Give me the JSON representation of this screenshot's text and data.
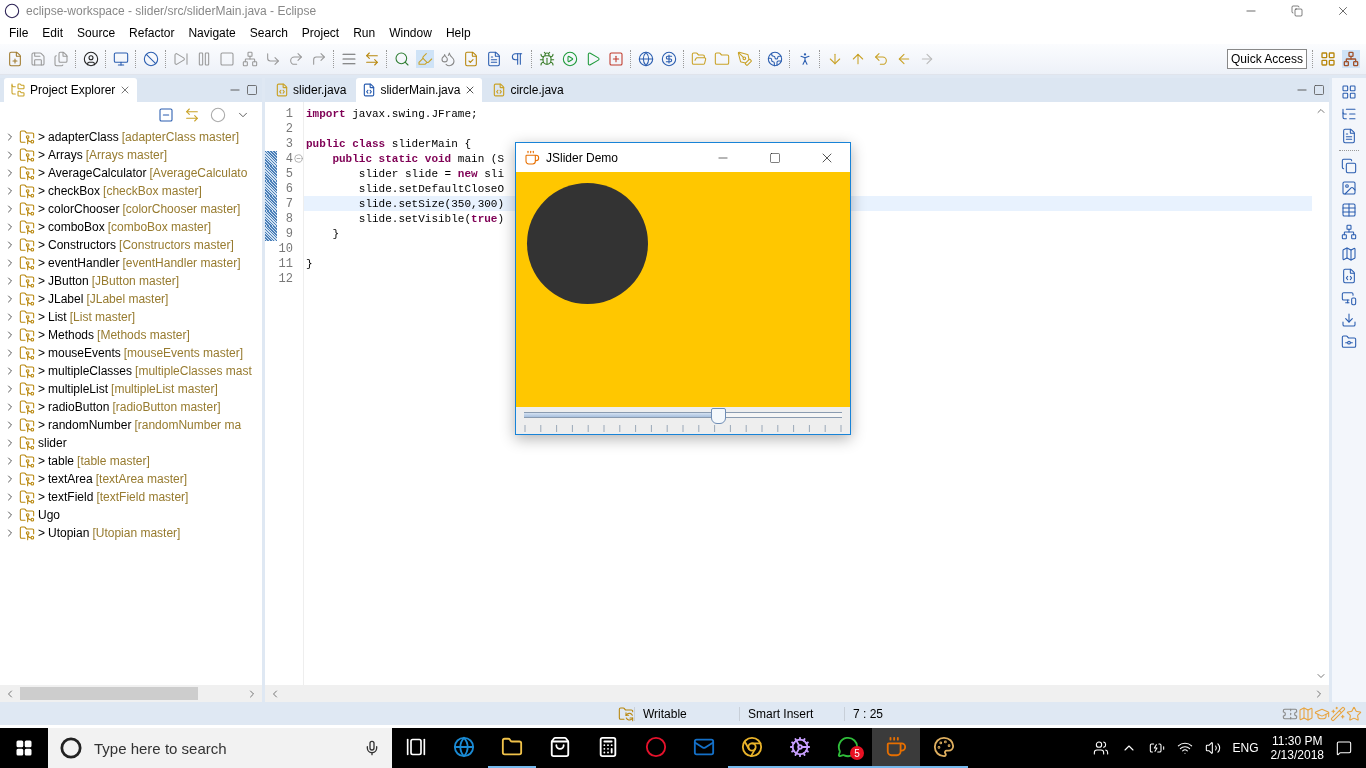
{
  "window": {
    "title": "eclipse-workspace - slider/src/sliderMain.java - Eclipse"
  },
  "menu": [
    "File",
    "Edit",
    "Source",
    "Refactor",
    "Navigate",
    "Search",
    "Project",
    "Run",
    "Window",
    "Help"
  ],
  "quick_access": {
    "placeholder": "Quick Access"
  },
  "project_explorer": {
    "title": "Project Explorer",
    "items": [
      {
        "name": "adapterClass",
        "marker": ">",
        "repo": "[adapterClass master]",
        "expanded": false
      },
      {
        "name": "Arrays",
        "marker": ">",
        "repo": "[Arrays master]",
        "expanded": false
      },
      {
        "name": "AverageCalculator",
        "marker": ">",
        "repo": "[AverageCalculato",
        "expanded": false
      },
      {
        "name": "checkBox",
        "marker": ">",
        "repo": "[checkBox master]",
        "expanded": false
      },
      {
        "name": "colorChooser",
        "marker": ">",
        "repo": "[colorChooser master]",
        "expanded": false
      },
      {
        "name": "comboBox",
        "marker": ">",
        "repo": "[comboBox master]",
        "expanded": false
      },
      {
        "name": "Constructors",
        "marker": ">",
        "repo": "[Constructors master]",
        "expanded": false
      },
      {
        "name": "eventHandler",
        "marker": ">",
        "repo": "[eventHandler master]",
        "expanded": false
      },
      {
        "name": "JButton",
        "marker": ">",
        "repo": "[JButton master]",
        "expanded": false
      },
      {
        "name": "JLabel",
        "marker": ">",
        "repo": "[JLabel master]",
        "expanded": false
      },
      {
        "name": "List",
        "marker": ">",
        "repo": "[List master]",
        "expanded": false
      },
      {
        "name": "Methods",
        "marker": ">",
        "repo": "[Methods master]",
        "expanded": false
      },
      {
        "name": "mouseEvents",
        "marker": ">",
        "repo": "[mouseEvents master]",
        "expanded": false
      },
      {
        "name": "multipleClasses",
        "marker": ">",
        "repo": "[multipleClasses mast",
        "expanded": false
      },
      {
        "name": "multipleList",
        "marker": ">",
        "repo": "[multipleList master]",
        "expanded": false
      },
      {
        "name": "radioButton",
        "marker": ">",
        "repo": "[radioButton master]",
        "expanded": false
      },
      {
        "name": "randomNumber",
        "marker": ">",
        "repo": "[randomNumber ma",
        "expanded": false
      },
      {
        "name": "slider",
        "expanded": false
      },
      {
        "name": "table",
        "marker": ">",
        "repo": "[table master]",
        "expanded": false
      },
      {
        "name": "textArea",
        "marker": ">",
        "repo": "[textArea master]",
        "expanded": false
      },
      {
        "name": "textField",
        "marker": ">",
        "repo": "[textField master]",
        "expanded": false
      },
      {
        "name": "Ugo",
        "expanded": false
      },
      {
        "name": "Utopian",
        "marker": ">",
        "repo": "[Utopian master]",
        "expanded": false
      }
    ]
  },
  "editor": {
    "tabs": [
      {
        "label": "slider.java",
        "selected": false,
        "warning": true
      },
      {
        "label": "sliderMain.java",
        "selected": true,
        "warning": false
      },
      {
        "label": "circle.java",
        "selected": false,
        "warning": true
      }
    ],
    "lines": [
      {
        "number": "1",
        "current": false,
        "changed": false,
        "foldable": false,
        "tokens": [
          {
            "kind": "keyword",
            "text": "import"
          },
          {
            "kind": "plain",
            "text": " javax.swing.JFrame;"
          }
        ]
      },
      {
        "number": "2",
        "current": false,
        "changed": false,
        "foldable": false
      },
      {
        "number": "3",
        "current": false,
        "changed": false,
        "foldable": false,
        "tokens": [
          {
            "kind": "keyword",
            "text": "public class"
          },
          {
            "kind": "plain",
            "text": " sliderMain {"
          }
        ]
      },
      {
        "number": "4",
        "current": false,
        "changed": true,
        "foldable": true,
        "tokens": [
          {
            "kind": "keyword",
            "text": "    public static void"
          },
          {
            "kind": "plain",
            "text": " main (S"
          }
        ]
      },
      {
        "number": "5",
        "current": false,
        "changed": true,
        "foldable": false,
        "tokens": [
          {
            "kind": "plain",
            "text": "        slider slide = "
          },
          {
            "kind": "keyword",
            "text": "new"
          },
          {
            "kind": "plain",
            "text": " sli"
          }
        ]
      },
      {
        "number": "6",
        "current": false,
        "changed": true,
        "foldable": false,
        "tokens": [
          {
            "kind": "plain",
            "text": "        slide.setDefaultCloseO"
          }
        ]
      },
      {
        "number": "7",
        "current": true,
        "changed": true,
        "foldable": false,
        "tokens": [
          {
            "kind": "plain",
            "text": "        slide.setSize(350,300)"
          }
        ]
      },
      {
        "number": "8",
        "current": false,
        "changed": true,
        "foldable": false,
        "tokens": [
          {
            "kind": "plain",
            "text": "        slide.setVisible("
          },
          {
            "kind": "keyword",
            "text": "true"
          },
          {
            "kind": "plain",
            "text": ")"
          }
        ]
      },
      {
        "number": "9",
        "current": false,
        "changed": true,
        "foldable": false,
        "tokens": [
          {
            "kind": "plain",
            "text": "    }"
          }
        ]
      },
      {
        "number": "10",
        "current": false,
        "changed": false,
        "foldable": false
      },
      {
        "number": "11",
        "current": false,
        "changed": false,
        "foldable": false,
        "tokens": [
          {
            "kind": "plain",
            "text": "}"
          }
        ]
      },
      {
        "number": "12",
        "current": false,
        "changed": false,
        "foldable": false
      }
    ]
  },
  "demo_window": {
    "title": "JSlider Demo",
    "slider": {
      "level": 0.61
    }
  },
  "status_bar": [
    "Writable",
    "Smart Insert",
    "7 : 25"
  ],
  "taskbar": {
    "search": {
      "placeholder": "Type here to search"
    },
    "apps": [
      {
        "kind": "edge",
        "running": false,
        "selected": false
      },
      {
        "kind": "explorer",
        "running": true,
        "selected": false
      },
      {
        "kind": "store",
        "running": false,
        "selected": false
      },
      {
        "kind": "calculator",
        "running": false,
        "selected": false
      },
      {
        "kind": "opera",
        "running": false,
        "selected": false
      },
      {
        "kind": "outlook",
        "running": false,
        "selected": false
      },
      {
        "kind": "chrome",
        "running": true,
        "selected": false
      },
      {
        "kind": "ide",
        "running": true,
        "selected": false
      },
      {
        "kind": "whatsapp",
        "running": true,
        "selected": false,
        "badge": "5"
      },
      {
        "kind": "java",
        "running": true,
        "selected": true
      },
      {
        "kind": "paint",
        "running": true,
        "selected": false
      }
    ],
    "language": "ENG",
    "time": "11:30 PM",
    "date": "2/13/2018"
  }
}
